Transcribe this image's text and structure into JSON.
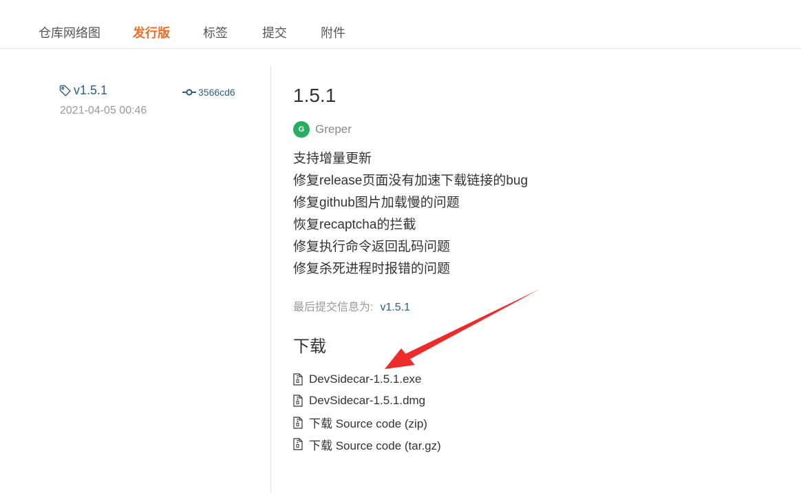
{
  "colors": {
    "accent": "#f56c20",
    "link": "#2c5d83",
    "avatar_bg": "#27ae60",
    "annotation_arrow": "#ee2b2b"
  },
  "tabs": [
    {
      "label": "仓库网络图"
    },
    {
      "label": "发行版"
    },
    {
      "label": "标签"
    },
    {
      "label": "提交"
    },
    {
      "label": "附件"
    }
  ],
  "release_meta": {
    "tag_icon": "tag-icon",
    "tag": "v1.5.1",
    "commit_icon": "commit-icon",
    "commit": "3566cd6",
    "date": "2021-04-05 00:46"
  },
  "release": {
    "title": "1.5.1",
    "author": {
      "initial": "G",
      "name": "Greper"
    },
    "notes": [
      "支持增量更新",
      "修复release页面没有加速下载链接的bug",
      "修复github图片加载慢的问题",
      "恢复recaptcha的拦截",
      "修复执行命令返回乱码问题",
      "修复杀死进程时报错的问题"
    ],
    "last_commit_label": "最后提交信息为:",
    "last_commit_value": "v1.5.1"
  },
  "downloads": {
    "heading": "下载",
    "file_icon": "file-zip-icon",
    "items": [
      {
        "label": "DevSidecar-1.5.1.exe"
      },
      {
        "label": "DevSidecar-1.5.1.dmg"
      },
      {
        "label": "下载 Source code (zip)"
      },
      {
        "label": "下载 Source code (tar.gz)"
      }
    ]
  }
}
